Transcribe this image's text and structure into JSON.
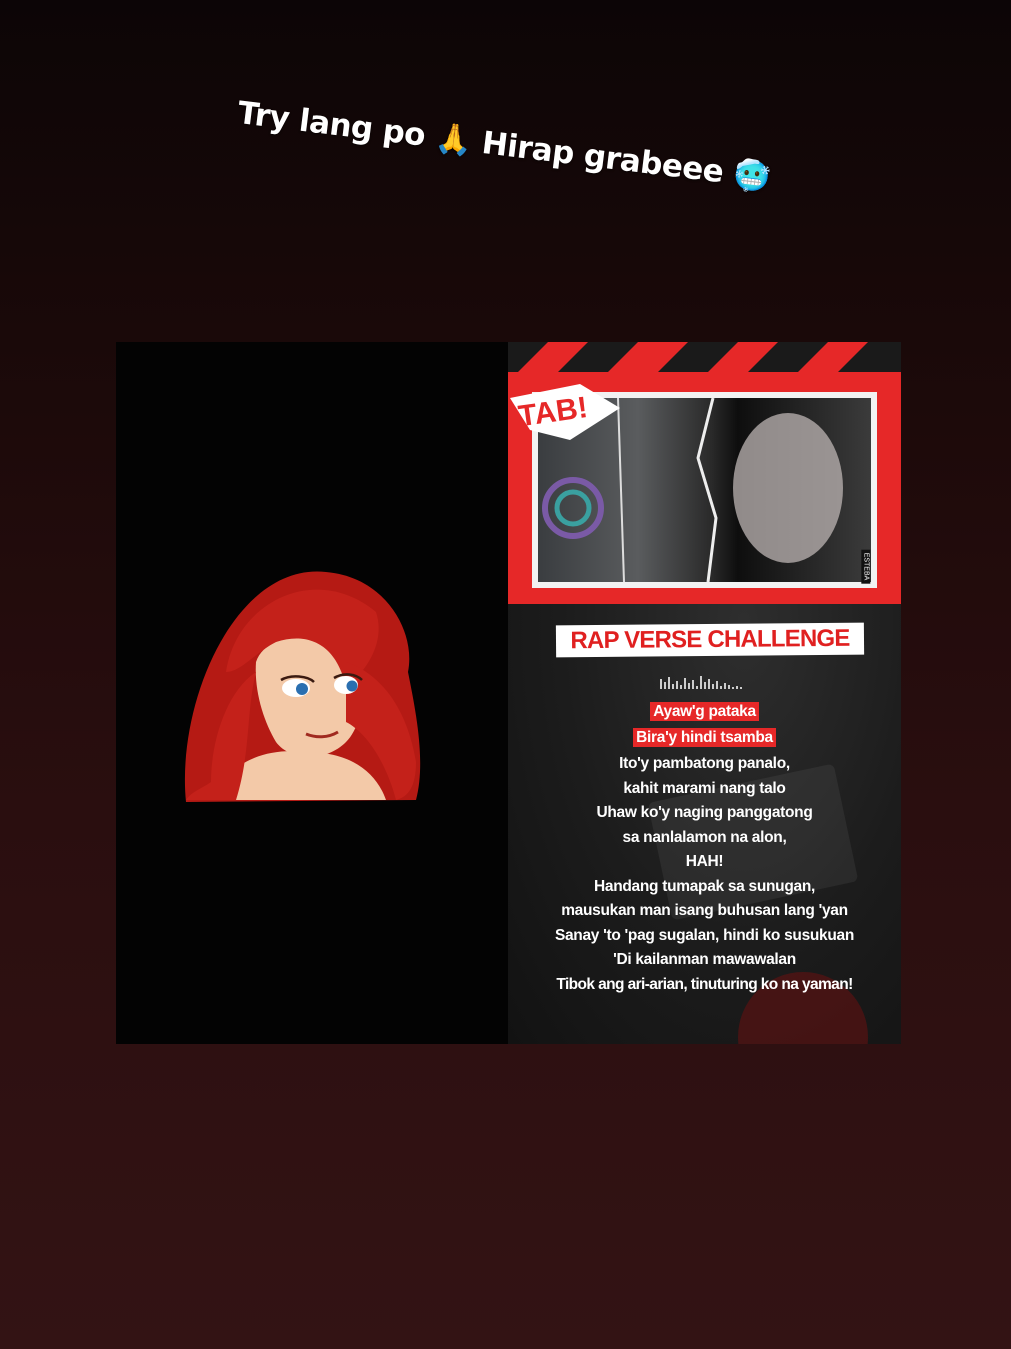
{
  "caption": {
    "text_a": "Try lang po",
    "emoji_a": "🙏",
    "text_b": "Hirap grabeee",
    "emoji_b": "🥶"
  },
  "poster": {
    "badge": "TAB!",
    "side_label": "ESTEBA",
    "title": "RAP VERSE CHALLENGE",
    "accent_color": "#e62828"
  },
  "lyrics": {
    "highlighted": [
      "Ayaw'g pataka",
      "Bira'y hindi tsamba"
    ],
    "lines": [
      "Ito'y pambatong panalo,",
      "kahit marami nang talo",
      "Uhaw ko'y naging panggatong",
      "sa nanlalamon na alon,",
      "HAH!",
      "Handang tumapak sa sunugan,",
      "mausukan man isang buhusan lang 'yan",
      "Sanay 'to 'pag sugalan, hindi ko susukuan",
      "'Di kailanman mawawalan",
      "Tibok ang ari-arian, tinuturing ko na yaman!"
    ]
  }
}
